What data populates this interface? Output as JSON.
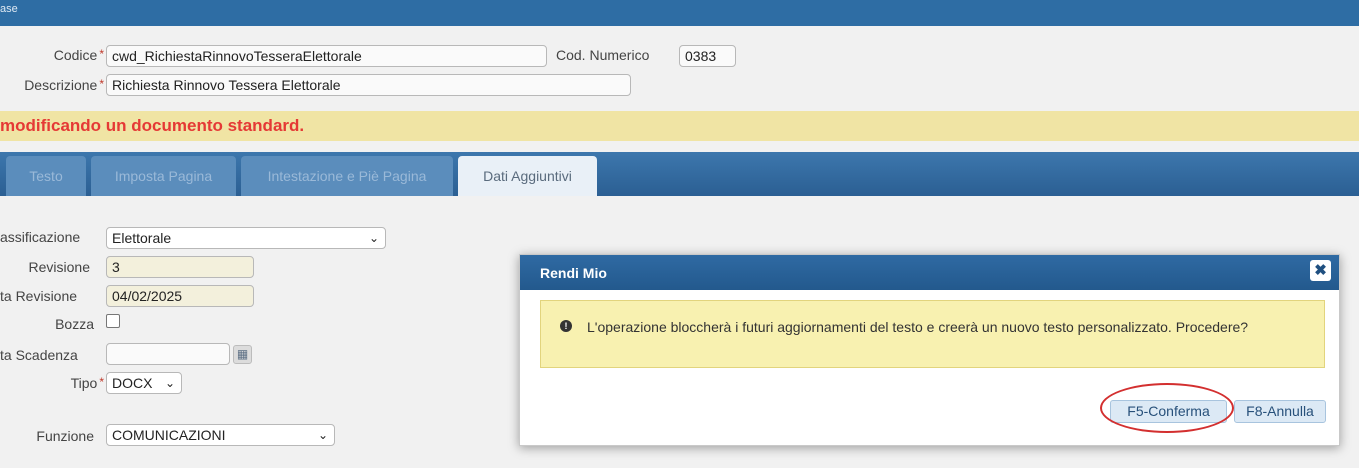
{
  "window": {
    "title_fragment": "ase"
  },
  "header_fields": {
    "codice_label": "Codice",
    "codice_value": "cwd_RichiestaRinnovoTesseraElettorale",
    "cod_numerico_label": "Cod. Numerico",
    "cod_numerico_value": "0383",
    "descrizione_label": "Descrizione",
    "descrizione_value": "Richiesta Rinnovo Tessera Elettorale",
    "required_mark": "*"
  },
  "warning": {
    "text": "modificando un documento standard."
  },
  "tabs": [
    {
      "label": "Testo",
      "active": false
    },
    {
      "label": "Imposta Pagina",
      "active": false
    },
    {
      "label": "Intestazione e Piè Pagina",
      "active": false
    },
    {
      "label": "Dati Aggiuntivi",
      "active": true
    }
  ],
  "form": {
    "classificazione_label": "assificazione",
    "classificazione_value": "Elettorale",
    "revisione_label": "Revisione",
    "revisione_value": "3",
    "data_revisione_label": "ta Revisione",
    "data_revisione_value": "04/02/2025",
    "bozza_label": "Bozza",
    "bozza_checked": false,
    "data_scadenza_label": "ta Scadenza",
    "data_scadenza_value": "",
    "tipo_label": "Tipo",
    "tipo_value": "DOCX",
    "funzione_label": "Funzione",
    "funzione_value": "COMUNICAZIONI"
  },
  "dialog": {
    "title": "Rendi Mio",
    "close_glyph": "✖",
    "message": "L'operazione bloccherà i futuri aggiornamenti del testo e creerà un nuovo testo personalizzato. Procedere?",
    "confirm_label": "F5-Conferma",
    "cancel_label": "F8-Annulla"
  },
  "icons": {
    "chevron_down": "⌄",
    "calendar": "▦",
    "exclamation": "!"
  },
  "colors": {
    "header_blue": "#2e6da4",
    "warning_red": "#e53935",
    "warning_bg": "#f0e4a4",
    "highlight_ring": "#d32f2f"
  }
}
